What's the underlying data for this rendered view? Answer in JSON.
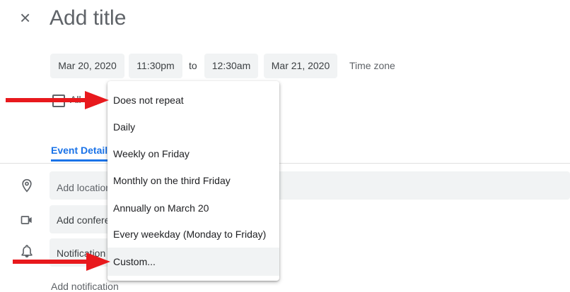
{
  "header": {
    "title_placeholder": "Add title",
    "close_icon": "close-icon"
  },
  "datetime": {
    "start_date": "Mar 20, 2020",
    "start_time": "11:30pm",
    "to": "to",
    "end_time": "12:30am",
    "end_date": "Mar 21, 2020",
    "time_zone": "Time zone"
  },
  "allday": {
    "label": "All day"
  },
  "tabs": {
    "event_details": "Event Details"
  },
  "fields": {
    "location": "Add location",
    "conference": "Add conferencing",
    "notification": "Notification",
    "add_notification": "Add notification"
  },
  "repeat_menu": {
    "items": [
      "Does not repeat",
      "Daily",
      "Weekly on Friday",
      "Monthly on the third Friday",
      "Annually on March 20",
      "Every weekday (Monday to Friday)",
      "Custom..."
    ],
    "highlighted_item": "Custom..."
  },
  "annotations": {
    "arrow_color": "#e8191d"
  },
  "colors": {
    "accent": "#1a73e8",
    "chip_bg": "#f1f3f4"
  }
}
